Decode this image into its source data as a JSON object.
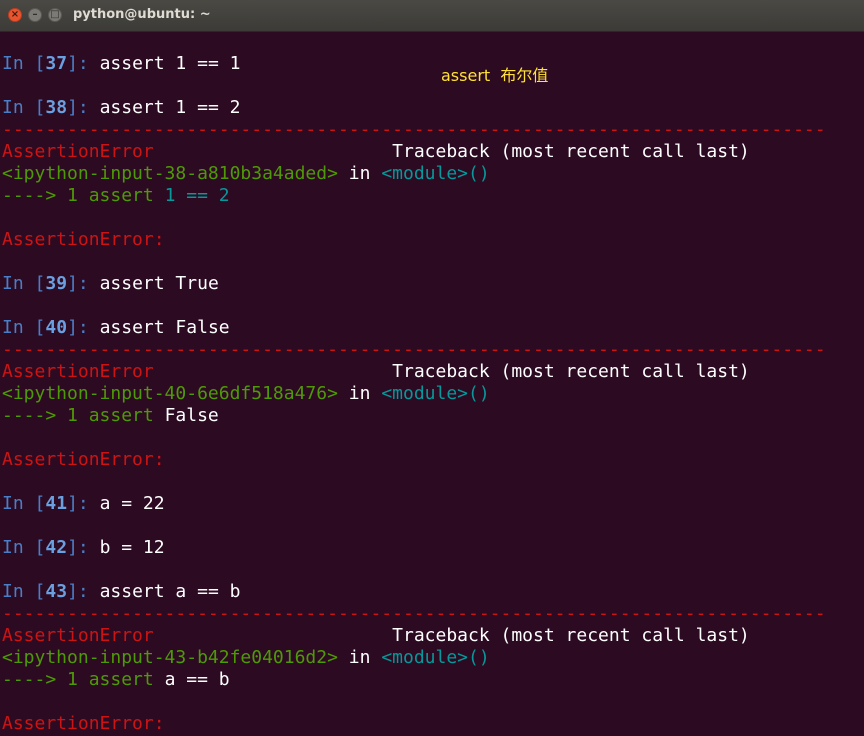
{
  "window": {
    "title": "python@ubuntu: ~",
    "close_glyph": "×",
    "minimize_glyph": "–",
    "maximize_glyph": "□"
  },
  "annotation": "assert  布尔值",
  "terminal": {
    "in_word": "In",
    "cells": [
      {
        "n": "37",
        "code": "assert 1 == 1"
      },
      {
        "n": "38",
        "code": "assert 1 == 2"
      },
      {
        "n": "39",
        "code": "assert True"
      },
      {
        "n": "40",
        "code": "assert False"
      },
      {
        "n": "41",
        "code": "a = 22"
      },
      {
        "n": "42",
        "code": "b = 12"
      },
      {
        "n": "43",
        "code": "assert a == b"
      }
    ],
    "separator": "----------------------------------------------------------------------------",
    "error_name": "AssertionError",
    "error_final": "AssertionError:",
    "traceback_header": "Traceback (most recent call last)",
    "tracebacks": [
      {
        "input": "<ipython-input-38-a810b3a4aded>",
        "arrow": "----> 1 ",
        "kw": "assert",
        "parts": [
          "1",
          "==",
          "2"
        ]
      },
      {
        "input": "<ipython-input-40-6e6df518a476>",
        "arrow": "----> 1 ",
        "kw": "assert",
        "parts": [
          "False"
        ]
      },
      {
        "input": "<ipython-input-43-b42fe04016d2>",
        "arrow": "----> 1 ",
        "kw": "assert",
        "parts": [
          "a",
          "==",
          "b"
        ]
      }
    ],
    "in_word_tb": "in",
    "module": "<module>",
    "parens": "()"
  }
}
